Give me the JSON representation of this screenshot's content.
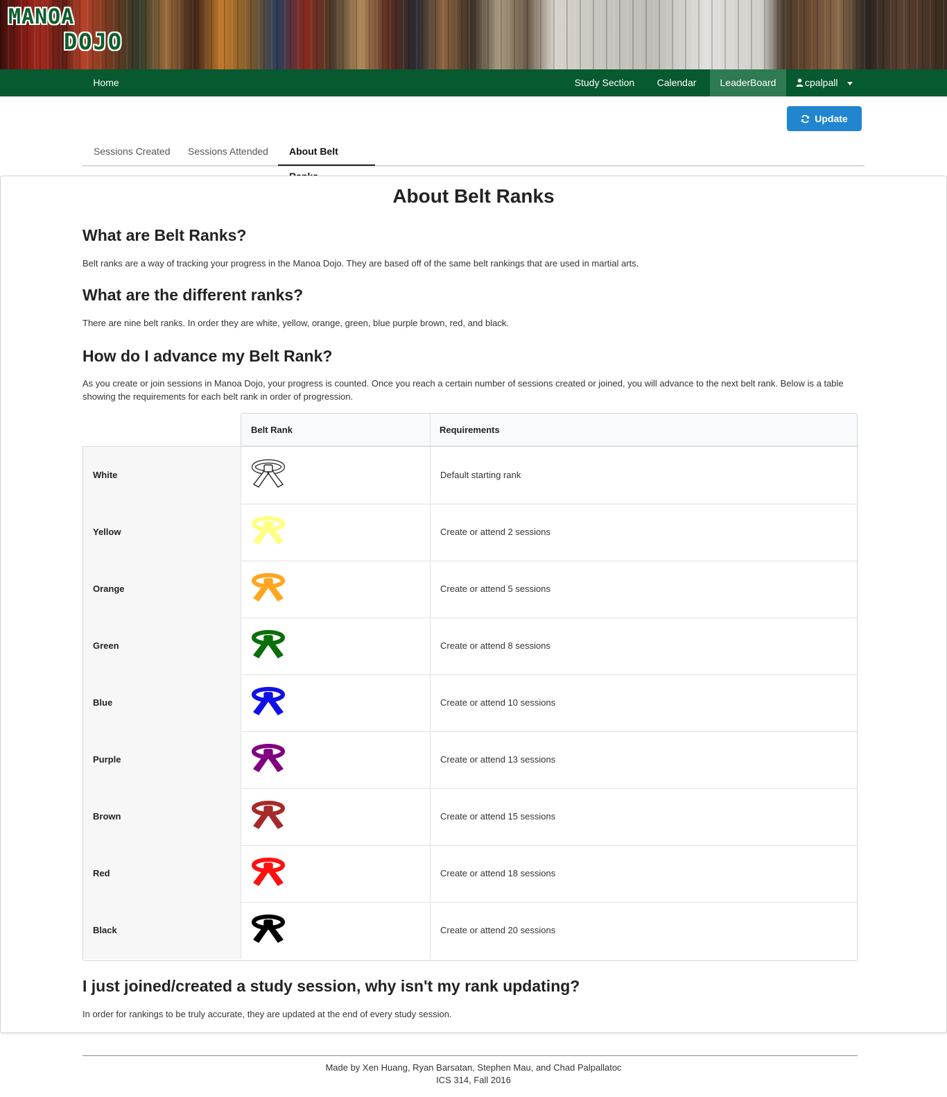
{
  "logo": {
    "line1": "MANOA",
    "line2": "DOJO"
  },
  "nav": {
    "home": "Home",
    "study_section": "Study Section",
    "calendar": "Calendar",
    "leaderboard": "LeaderBoard",
    "user": "cpalpall"
  },
  "update_label": "Update",
  "tabs": [
    "Sessions Created",
    "Sessions Attended",
    "About Belt Ranks"
  ],
  "page_title": "About Belt Ranks",
  "sections": [
    {
      "heading": "What are Belt Ranks?",
      "text": "Belt ranks are a way of tracking your progress in the Manoa Dojo. They are based off of the same belt rankings that are used in martial arts."
    },
    {
      "heading": "What are the different ranks?",
      "text": "There are nine belt ranks. In order they are white, yellow, orange, green, blue purple brown, red, and black."
    },
    {
      "heading": "How do I advance my Belt Rank?",
      "text": "As you create or join sessions in Manoa Dojo, your progress is counted. Once you reach a certain number of sessions created or joined, you will advance to the next belt rank. Below is a table showing the requirements for each belt rank in order of progression."
    },
    {
      "heading": "I just joined/created a study session, why isn't my rank updating?",
      "text": "In order for rankings to be truly accurate, they are updated at the end of every study session."
    }
  ],
  "table": {
    "headers": [
      "Belt Rank",
      "Requirements"
    ],
    "rows": [
      {
        "name": "White",
        "color": "#ffffff",
        "outline": "#222222",
        "requirement": "Default starting rank"
      },
      {
        "name": "Yellow",
        "color": "#ffff80",
        "outline": "#ffff80",
        "requirement": "Create or attend 2 sessions"
      },
      {
        "name": "Orange",
        "color": "#ffa620",
        "outline": "#ffa620",
        "requirement": "Create or attend 5 sessions"
      },
      {
        "name": "Green",
        "color": "#0a6e0a",
        "outline": "#0a6e0a",
        "requirement": "Create or attend 8 sessions"
      },
      {
        "name": "Blue",
        "color": "#1010e6",
        "outline": "#1010e6",
        "requirement": "Create or attend 10 sessions"
      },
      {
        "name": "Purple",
        "color": "#800080",
        "outline": "#800080",
        "requirement": "Create or attend 13 sessions"
      },
      {
        "name": "Brown",
        "color": "#a52a2a",
        "outline": "#a52a2a",
        "requirement": "Create or attend 15 sessions"
      },
      {
        "name": "Red",
        "color": "#ff1010",
        "outline": "#ff1010",
        "requirement": "Create or attend 18 sessions"
      },
      {
        "name": "Black",
        "color": "#000000",
        "outline": "#000000",
        "requirement": "Create or attend 20 sessions"
      }
    ]
  },
  "footer": {
    "line1": "Made by Xen Huang, Ryan Barsatan, Stephen Mau, and Chad Palpallatoc",
    "line2": "ICS 314, Fall 2016"
  }
}
